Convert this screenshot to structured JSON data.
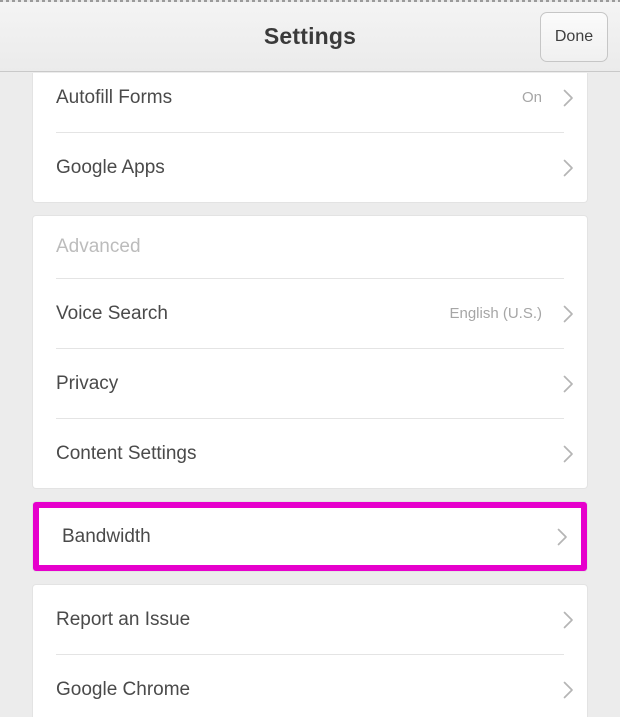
{
  "header": {
    "title": "Settings",
    "done_label": "Done",
    "title_color": "#3a3a3a"
  },
  "highlight": {
    "color": "#e600cc",
    "target": "Bandwidth"
  },
  "icons": {
    "chevron": "chevron-right-icon"
  },
  "sections": [
    {
      "id": "top",
      "header": null,
      "rows": [
        {
          "label": "Autofill Forms",
          "value": "On",
          "chevron": true
        },
        {
          "label": "Google Apps",
          "value": "",
          "chevron": true
        }
      ]
    },
    {
      "id": "advanced",
      "header": "Advanced",
      "rows": [
        {
          "label": "Voice Search",
          "value": "English (U.S.)",
          "chevron": true
        },
        {
          "label": "Privacy",
          "value": "",
          "chevron": true
        },
        {
          "label": "Content Settings",
          "value": "",
          "chevron": true
        }
      ]
    },
    {
      "id": "bandwidth",
      "header": null,
      "highlighted": true,
      "rows": [
        {
          "label": "Bandwidth",
          "value": "",
          "chevron": true
        }
      ]
    },
    {
      "id": "about",
      "header": null,
      "rows": [
        {
          "label": "Report an Issue",
          "value": "",
          "chevron": true
        },
        {
          "label": "Google Chrome",
          "value": "",
          "chevron": true
        }
      ]
    }
  ]
}
